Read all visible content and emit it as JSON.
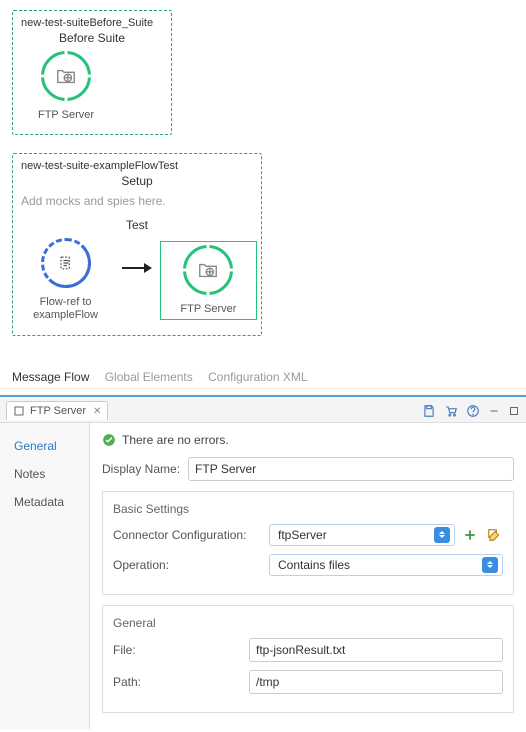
{
  "suite1": {
    "name": "new-test-suiteBefore_Suite",
    "section": "Before Suite",
    "node": "FTP Server"
  },
  "suite2": {
    "name": "new-test-suite-exampleFlowTest",
    "setup": "Setup",
    "hint": "Add mocks and spies here.",
    "test": "Test",
    "node_flowref": "Flow-ref to exampleFlow",
    "node_ftp": "FTP Server"
  },
  "topTabs": {
    "flow": "Message Flow",
    "globals": "Global Elements",
    "xml": "Configuration XML"
  },
  "panel": {
    "title": "FTP Server",
    "status": "There are no errors.",
    "sideNav": {
      "general": "General",
      "notes": "Notes",
      "metadata": "Metadata"
    },
    "displayName": {
      "label": "Display Name:",
      "value": "FTP Server"
    },
    "basicSettings": {
      "legend": "Basic Settings",
      "connectorLabel": "Connector Configuration:",
      "connectorValue": "ftpServer",
      "operationLabel": "Operation:",
      "operationValue": "Contains files"
    },
    "general": {
      "legend": "General",
      "fileLabel": "File:",
      "fileValue": "ftp-jsonResult.txt",
      "pathLabel": "Path:",
      "pathValue": "/tmp"
    }
  }
}
